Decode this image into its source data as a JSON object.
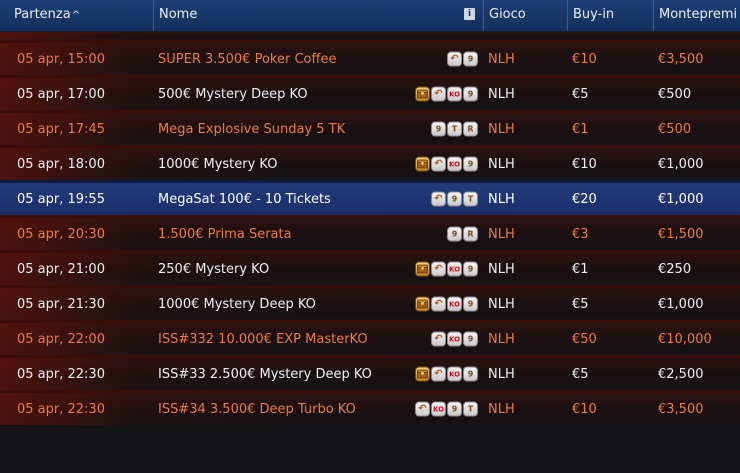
{
  "header": {
    "start": "Partenza",
    "sort_indicator": "^",
    "name": "Nome",
    "info": "i",
    "game": "Gioco",
    "buyin": "Buy-in",
    "prize": "Montepremi"
  },
  "rows": [
    {
      "time": "05 apr, 15:00",
      "name": "SUPER 3.500€ Poker Coffee",
      "game": "NLH",
      "buyin": "€10",
      "prize": "€3,500",
      "highlight": true,
      "badges": [
        "redo-icon",
        "nine-badge"
      ]
    },
    {
      "time": "05 apr, 17:00",
      "name": "500€ Mystery Deep KO",
      "game": "NLH",
      "buyin": "€5",
      "prize": "€500",
      "highlight": false,
      "badges": [
        "chest-icon",
        "redo-icon",
        "ko-badge",
        "nine-badge"
      ]
    },
    {
      "time": "05 apr, 17:45",
      "name": "Mega Explosive Sunday 5 TK",
      "game": "NLH",
      "buyin": "€1",
      "prize": "€500",
      "highlight": true,
      "badges": [
        "nine-badge",
        "t-badge",
        "r-badge"
      ]
    },
    {
      "time": "05 apr, 18:00",
      "name": "1000€ Mystery KO",
      "game": "NLH",
      "buyin": "€10",
      "prize": "€1,000",
      "highlight": false,
      "badges": [
        "chest-icon",
        "redo-icon",
        "ko-badge",
        "nine-badge"
      ]
    },
    {
      "time": "05 apr, 19:55",
      "name": "MegaSat 100€ - 10 Tickets",
      "game": "NLH",
      "buyin": "€20",
      "prize": "€1,000",
      "highlight": false,
      "selected": true,
      "badges": [
        "redo-icon",
        "nine-badge",
        "t-badge"
      ]
    },
    {
      "time": "05 apr, 20:30",
      "name": "1.500€ Prima Serata",
      "game": "NLH",
      "buyin": "€3",
      "prize": "€1,500",
      "highlight": true,
      "badges": [
        "nine-badge",
        "r-badge"
      ]
    },
    {
      "time": "05 apr, 21:00",
      "name": "250€ Mystery KO",
      "game": "NLH",
      "buyin": "€1",
      "prize": "€250",
      "highlight": false,
      "badges": [
        "chest-icon",
        "redo-icon",
        "ko-badge",
        "nine-badge"
      ]
    },
    {
      "time": "05 apr, 21:30",
      "name": "1000€ Mystery Deep KO",
      "game": "NLH",
      "buyin": "€5",
      "prize": "€1,000",
      "highlight": false,
      "badges": [
        "chest-icon",
        "redo-icon",
        "ko-badge",
        "nine-badge"
      ]
    },
    {
      "time": "05 apr, 22:00",
      "name": "ISS#332 10.000€ EXP MasterKO",
      "game": "NLH",
      "buyin": "€50",
      "prize": "€10,000",
      "highlight": true,
      "badges": [
        "redo-icon",
        "ko-badge",
        "nine-badge"
      ]
    },
    {
      "time": "05 apr, 22:30",
      "name": "ISS#33 2.500€ Mystery Deep KO",
      "game": "NLH",
      "buyin": "€5",
      "prize": "€2,500",
      "highlight": false,
      "badges": [
        "chest-icon",
        "redo-icon",
        "ko-badge",
        "nine-badge"
      ]
    },
    {
      "time": "05 apr, 22:30",
      "name": "ISS#34 3.500€ Deep Turbo KO",
      "game": "NLH",
      "buyin": "€10",
      "prize": "€3,500",
      "highlight": true,
      "badges": [
        "redo-icon",
        "ko-badge",
        "nine-badge",
        "t-badge"
      ]
    }
  ],
  "badge_glyphs": {
    "nine-badge": "9",
    "t-badge": "T",
    "r-badge": "R",
    "ko-badge": "KO",
    "redo-icon": "↶",
    "chest-icon": ""
  },
  "colors": {
    "highlight_text": "#f07a3c",
    "selected_row": "#1f3575",
    "header_bg": "#1b3a70"
  }
}
